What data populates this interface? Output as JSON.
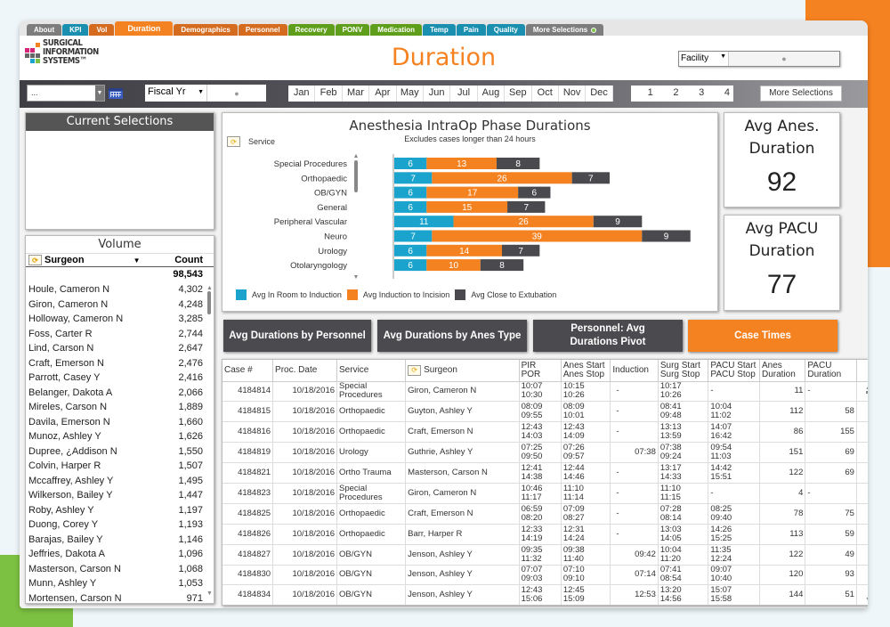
{
  "tabs": [
    {
      "label": "About",
      "color": "gray"
    },
    {
      "label": "KPI",
      "color": "blue"
    },
    {
      "label": "Vol",
      "color": "orange"
    },
    {
      "label": "Duration",
      "color": "active"
    },
    {
      "label": "Demographics",
      "color": "orange"
    },
    {
      "label": "Personnel",
      "color": "orange"
    },
    {
      "label": "Recovery",
      "color": "green"
    },
    {
      "label": "PONV",
      "color": "green"
    },
    {
      "label": "Medication",
      "color": "green"
    },
    {
      "label": "Temp",
      "color": "blue"
    },
    {
      "label": "Pain",
      "color": "blue"
    },
    {
      "label": "Quality",
      "color": "blue"
    },
    {
      "label": "More Selections",
      "color": "gray"
    }
  ],
  "header": {
    "logo_lines": [
      "SURGICAL",
      "INFORMATION",
      "SYSTEMS™"
    ],
    "title": "Duration",
    "facility_label": "Facility"
  },
  "filters": {
    "date_select_value": "...",
    "fiscal_label": "Fiscal Yr",
    "months": [
      "Jan",
      "Feb",
      "Mar",
      "Apr",
      "May",
      "Jun",
      "Jul",
      "Aug",
      "Sep",
      "Oct",
      "Nov",
      "Dec"
    ],
    "quarters": [
      "1",
      "2",
      "3",
      "4"
    ],
    "more_selections": "More Selections"
  },
  "current_selections": {
    "title": "Current Selections"
  },
  "volume": {
    "title": "Volume",
    "col_surgeon": "Surgeon",
    "col_count": "Count",
    "total": "98,543",
    "rows": [
      {
        "name": "Houle, Cameron N",
        "count": "4,302"
      },
      {
        "name": "Giron, Cameron N",
        "count": "4,248"
      },
      {
        "name": "Holloway, Cameron N",
        "count": "3,285"
      },
      {
        "name": "Foss, Carter R",
        "count": "2,744"
      },
      {
        "name": "Lind, Carson N",
        "count": "2,647"
      },
      {
        "name": "Craft, Emerson N",
        "count": "2,476"
      },
      {
        "name": "Parrott, Casey Y",
        "count": "2,416"
      },
      {
        "name": "Belanger, Dakota A",
        "count": "2,066"
      },
      {
        "name": "Mireles, Carson N",
        "count": "1,889"
      },
      {
        "name": "Davila, Emerson N",
        "count": "1,660"
      },
      {
        "name": "Munoz, Ashley Y",
        "count": "1,626"
      },
      {
        "name": "Dupree, ¿Addison N",
        "count": "1,550"
      },
      {
        "name": "Colvin, Harper R",
        "count": "1,507"
      },
      {
        "name": "Mccaffrey, Ashley Y",
        "count": "1,495"
      },
      {
        "name": "Wilkerson, Bailey Y",
        "count": "1,447"
      },
      {
        "name": "Roby, Ashley Y",
        "count": "1,197"
      },
      {
        "name": "Duong, Corey Y",
        "count": "1,193"
      },
      {
        "name": "Barajas, Bailey Y",
        "count": "1,146"
      },
      {
        "name": "Jeffries, Dakota A",
        "count": "1,096"
      },
      {
        "name": "Masterson, Carson N",
        "count": "1,068"
      },
      {
        "name": "Munn, Ashley Y",
        "count": "1,053"
      },
      {
        "name": "Mortensen, Carson N",
        "count": "971"
      }
    ]
  },
  "chart_data": {
    "type": "bar",
    "orientation": "horizontal",
    "stacked": true,
    "title": "Anesthesia IntraOp Phase Durations",
    "subtitle": "Excludes cases longer than 24 hours",
    "dimension_label": "Service",
    "categories": [
      "Special Procedures",
      "Orthopaedic",
      "OB/GYN",
      "General",
      "Peripheral Vascular",
      "Neuro",
      "Urology",
      "Otolaryngology"
    ],
    "series": [
      {
        "name": "Avg In Room to Induction",
        "color": "#1aa3cc",
        "values": [
          6,
          7,
          6,
          6,
          11,
          7,
          6,
          6
        ]
      },
      {
        "name": "Avg Induction to Incision",
        "color": "#f58220",
        "values": [
          13,
          26,
          17,
          15,
          26,
          39,
          14,
          10
        ]
      },
      {
        "name": "Avg Close to Extubation",
        "color": "#4a4a4e",
        "values": [
          8,
          7,
          6,
          7,
          9,
          9,
          7,
          8
        ]
      }
    ],
    "legend_position": "bottom-left",
    "grid": false
  },
  "kpis": [
    {
      "title_1": "Avg Anes.",
      "title_2": "Duration",
      "value": "92"
    },
    {
      "title_1": "Avg PACU",
      "title_2": "Duration",
      "value": "77"
    }
  ],
  "nav_buttons": [
    {
      "label": "Avg Durations by Personnel",
      "active": false
    },
    {
      "label": "Avg Durations by Anes Type",
      "active": false
    },
    {
      "label": "Personnel: Avg Durations Pivot",
      "active": false
    },
    {
      "label": "Case Times",
      "active": true
    }
  ],
  "case_table": {
    "headers": [
      "Case #",
      "Proc. Date",
      "Service",
      "Surgeon",
      "PIR\nPOR",
      "Anes Start\nAnes Stop",
      "Induction",
      "Surg Start\nSurg Stop",
      "PACU Start\nPACU Stop",
      "Anes\nDuration",
      "PACU\nDuration"
    ],
    "rows": [
      {
        "case": "4184814",
        "date": "10/18/2016",
        "service": "Special Procedures",
        "surgeon": "Giron, Cameron N",
        "pir": "10:07",
        "por": "10:30",
        "anes_start": "10:15",
        "anes_stop": "10:26",
        "induction": "-",
        "surg_start": "10:17",
        "surg_stop": "10:26",
        "pacu_start": "-",
        "pacu_stop": "",
        "anes_dur": "11",
        "pacu_dur": "-"
      },
      {
        "case": "4184815",
        "date": "10/18/2016",
        "service": "Orthopaedic",
        "surgeon": "Guyton, Ashley Y",
        "pir": "08:09",
        "por": "09:55",
        "anes_start": "08:09",
        "anes_stop": "10:01",
        "induction": "-",
        "surg_start": "08:41",
        "surg_stop": "09:48",
        "pacu_start": "10:04",
        "pacu_stop": "11:02",
        "anes_dur": "112",
        "pacu_dur": "58"
      },
      {
        "case": "4184816",
        "date": "10/18/2016",
        "service": "Orthopaedic",
        "surgeon": "Craft, Emerson N",
        "pir": "12:43",
        "por": "14:03",
        "anes_start": "12:43",
        "anes_stop": "14:09",
        "induction": "-",
        "surg_start": "13:13",
        "surg_stop": "13:59",
        "pacu_start": "14:07",
        "pacu_stop": "16:42",
        "anes_dur": "86",
        "pacu_dur": "155"
      },
      {
        "case": "4184819",
        "date": "10/18/2016",
        "service": "Urology",
        "surgeon": "Guthrie, Ashley Y",
        "pir": "07:25",
        "por": "09:50",
        "anes_start": "07:26",
        "anes_stop": "09:57",
        "induction": "07:38",
        "surg_start": "07:38",
        "surg_stop": "09:24",
        "pacu_start": "09:54",
        "pacu_stop": "11:03",
        "anes_dur": "151",
        "pacu_dur": "69"
      },
      {
        "case": "4184821",
        "date": "10/18/2016",
        "service": "Ortho Trauma",
        "surgeon": "Masterson, Carson N",
        "pir": "12:41",
        "por": "14:38",
        "anes_start": "12:44",
        "anes_stop": "14:46",
        "induction": "-",
        "surg_start": "13:17",
        "surg_stop": "14:33",
        "pacu_start": "14:42",
        "pacu_stop": "15:51",
        "anes_dur": "122",
        "pacu_dur": "69"
      },
      {
        "case": "4184823",
        "date": "10/18/2016",
        "service": "Special Procedures",
        "surgeon": "Giron, Cameron N",
        "pir": "10:46",
        "por": "11:17",
        "anes_start": "11:10",
        "anes_stop": "11:14",
        "induction": "-",
        "surg_start": "11:10",
        "surg_stop": "11:15",
        "pacu_start": "-",
        "pacu_stop": "",
        "anes_dur": "4",
        "pacu_dur": "-"
      },
      {
        "case": "4184825",
        "date": "10/18/2016",
        "service": "Orthopaedic",
        "surgeon": "Craft, Emerson N",
        "pir": "06:59",
        "por": "08:20",
        "anes_start": "07:09",
        "anes_stop": "08:27",
        "induction": "-",
        "surg_start": "07:28",
        "surg_stop": "08:14",
        "pacu_start": "08:25",
        "pacu_stop": "09:40",
        "anes_dur": "78",
        "pacu_dur": "75"
      },
      {
        "case": "4184826",
        "date": "10/18/2016",
        "service": "Orthopaedic",
        "surgeon": "Barr, Harper R",
        "pir": "12:33",
        "por": "14:19",
        "anes_start": "12:31",
        "anes_stop": "14:24",
        "induction": "-",
        "surg_start": "13:03",
        "surg_stop": "14:05",
        "pacu_start": "14:26",
        "pacu_stop": "15:25",
        "anes_dur": "113",
        "pacu_dur": "59"
      },
      {
        "case": "4184827",
        "date": "10/18/2016",
        "service": "OB/GYN",
        "surgeon": "Jenson, Ashley Y",
        "pir": "09:35",
        "por": "11:32",
        "anes_start": "09:38",
        "anes_stop": "11:40",
        "induction": "09:42",
        "surg_start": "10:04",
        "surg_stop": "11:20",
        "pacu_start": "11:35",
        "pacu_stop": "12:24",
        "anes_dur": "122",
        "pacu_dur": "49"
      },
      {
        "case": "4184830",
        "date": "10/18/2016",
        "service": "OB/GYN",
        "surgeon": "Jenson, Ashley Y",
        "pir": "07:07",
        "por": "09:03",
        "anes_start": "07:10",
        "anes_stop": "09:10",
        "induction": "07:14",
        "surg_start": "07:41",
        "surg_stop": "08:54",
        "pacu_start": "09:07",
        "pacu_stop": "10:40",
        "anes_dur": "120",
        "pacu_dur": "93"
      },
      {
        "case": "4184834",
        "date": "10/18/2016",
        "service": "OB/GYN",
        "surgeon": "Jenson, Ashley Y",
        "pir": "12:43",
        "por": "15:06",
        "anes_start": "12:45",
        "anes_stop": "15:09",
        "induction": "12:53",
        "surg_start": "13:20",
        "surg_stop": "14:56",
        "pacu_start": "15:07",
        "pacu_stop": "15:58",
        "anes_dur": "144",
        "pacu_dur": "51"
      }
    ]
  }
}
